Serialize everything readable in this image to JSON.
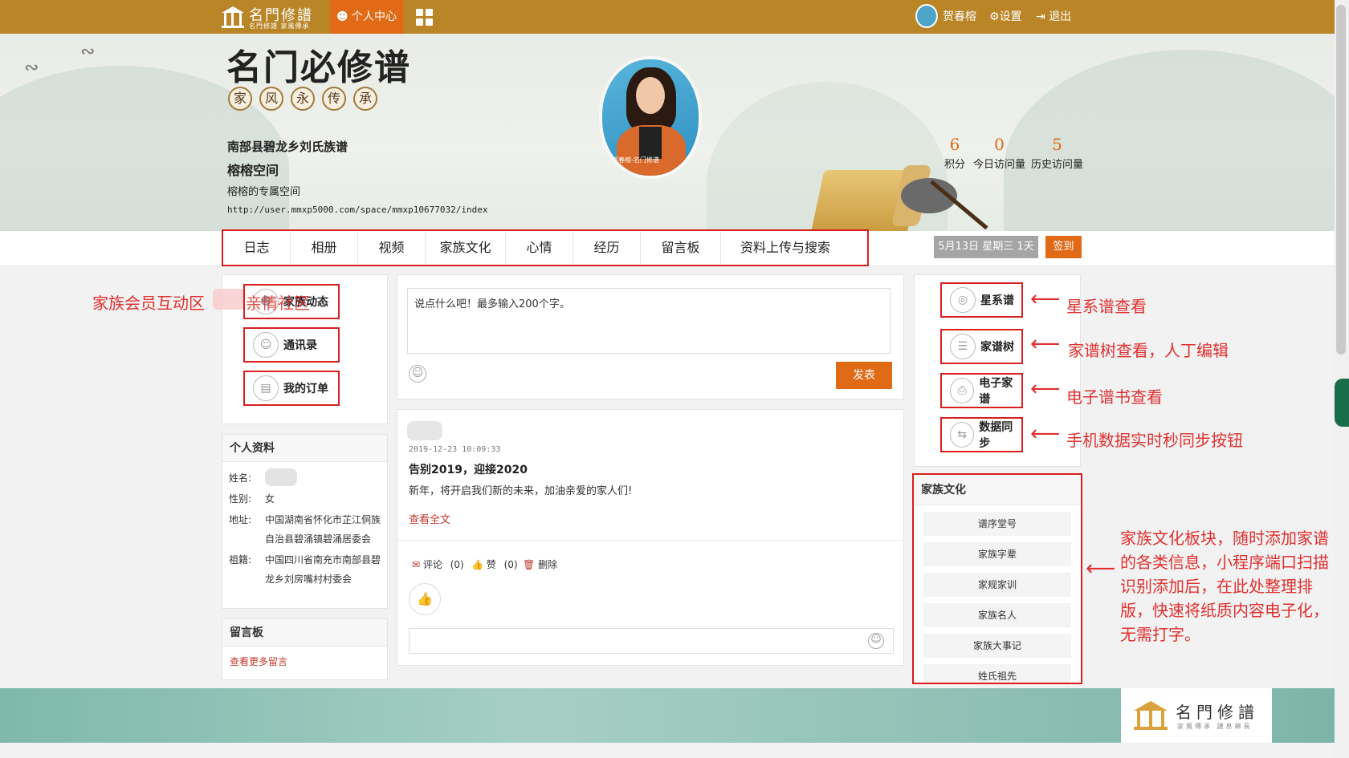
{
  "topbar": {
    "logo_title": "名門修譜",
    "logo_sub": "名門修譜 家風傳承",
    "active_tab": "个人中心",
    "user_name": "贺春榕",
    "settings": "设置",
    "logout": "退出"
  },
  "banner": {
    "title": "名门必修谱",
    "circles": [
      "家",
      "风",
      "永",
      "传",
      "承"
    ],
    "clan_name": "南部县碧龙乡刘氏族谱",
    "space_name": "榕榕空间",
    "space_desc": "榕榕的专属空间",
    "url": "http://user.mmxp5000.com/space/mmxp10677032/index",
    "avatar_caption": "贺春榕-名门修谱",
    "stats": [
      {
        "value": "6",
        "label": "积分"
      },
      {
        "value": "0",
        "label": "今日访问量"
      },
      {
        "value": "5",
        "label": "历史访问量"
      }
    ]
  },
  "nav": {
    "items": [
      "日志",
      "相册",
      "视频",
      "家族文化",
      "心情",
      "经历",
      "留言板",
      "资料上传与搜索"
    ],
    "date": "5月13日 星期三 1天",
    "sign": "签到"
  },
  "left": {
    "buttons": [
      "家族动态",
      "通讯录",
      "我的订单"
    ],
    "profile_title": "个人资料",
    "profile": {
      "name_key": "姓名:",
      "gender_key": "性别:",
      "gender": "女",
      "address_key": "地址:",
      "address": "中国湖南省怀化市芷江侗族自治县碧涌镇碧涌居委会",
      "origin_key": "祖籍:",
      "origin": "中国四川省南充市南部县碧龙乡刘房嘴村村委会"
    },
    "message_title": "留言板",
    "message_link": "查看更多留言"
  },
  "center": {
    "post_placeholder": "说点什么吧！最多输入200个字。",
    "post_button": "发表",
    "feed": {
      "time": "2019-12-23 10:09:33",
      "title": "告别2019，迎接2020",
      "body": "新年，将开启我们新的未来，加油亲爱的家人们!",
      "more": "查看全文",
      "comment": "评论",
      "comment_count": "(0)",
      "like": "赞",
      "like_count": "(0)",
      "delete": "删除"
    }
  },
  "right": {
    "buttons": [
      "星系谱",
      "家谱树",
      "电子家谱",
      "数据同步"
    ],
    "culture_title": "家族文化",
    "culture_items": [
      "谱序堂号",
      "家族字辈",
      "家规家训",
      "家族名人",
      "家族大事记",
      "姓氏祖先"
    ]
  },
  "annotations": {
    "left_area": "家族会员互动区",
    "left_overlay": "亲情社区",
    "star": "星系谱查看",
    "tree": "家谱树查看，人丁编辑",
    "ebook": "电子谱书查看",
    "sync": "手机数据实时秒同步按钮",
    "culture": "家族文化板块，随时添加家谱的各类信息，小程序端口扫描识别添加后，在此处整理排版，快速将纸质内容电子化，无需打字。"
  },
  "footer": {
    "logo_title": "名門修譜",
    "logo_sub": "家風傳承 譜息綿長"
  },
  "colors": {
    "topbar": "#b98527",
    "accent": "#e06a15",
    "annotation": "#e03030"
  }
}
